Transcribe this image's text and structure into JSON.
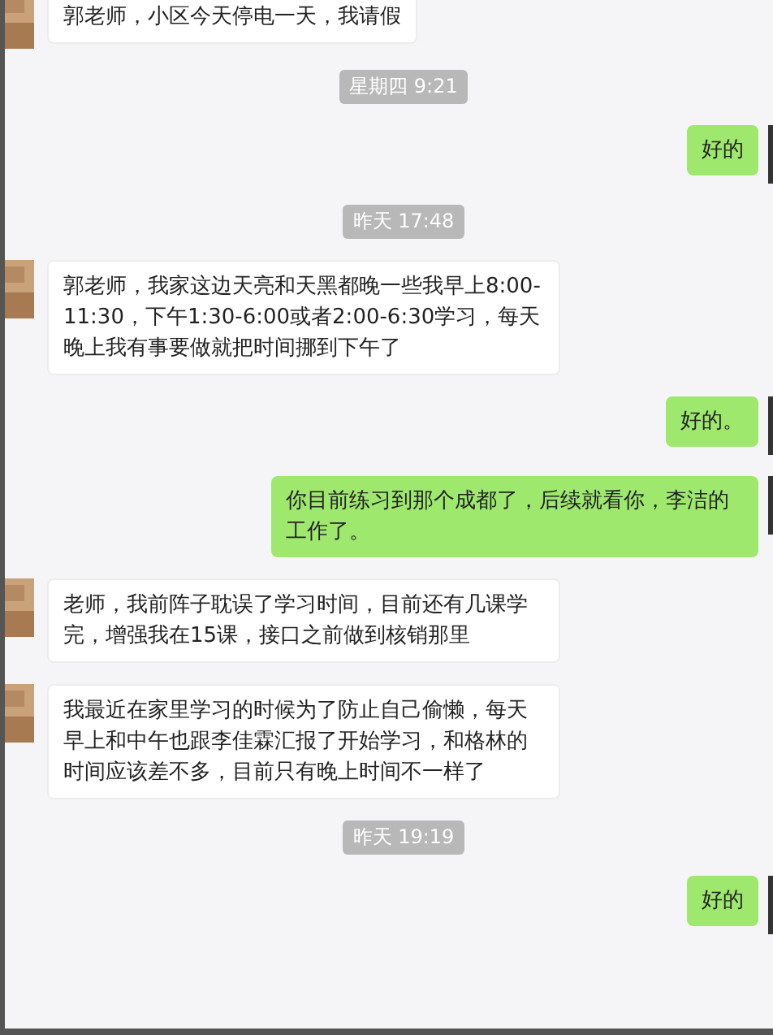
{
  "messages": [
    {
      "kind": "incoming",
      "text": "郭老师，小区今天停电一天，我请假"
    },
    {
      "kind": "time",
      "text": "星期四 9:21"
    },
    {
      "kind": "outgoing",
      "text": "好的"
    },
    {
      "kind": "time",
      "text": "昨天 17:48"
    },
    {
      "kind": "incoming",
      "text": "郭老师，我家这边天亮和天黑都晚一些我早上8:00-11:30，下午1:30-6:00或者2:00-6:30学习，每天晚上我有事要做就把时间挪到下午了"
    },
    {
      "kind": "outgoing",
      "text": "好的。"
    },
    {
      "kind": "outgoing",
      "text": "你目前练习到那个成都了，后续就看你，李洁的工作了。"
    },
    {
      "kind": "incoming",
      "text": "老师，我前阵子耽误了学习时间，目前还有几课学完，增强我在15课，接口之前做到核销那里"
    },
    {
      "kind": "incoming",
      "text": "我最近在家里学习的时候为了防止自己偷懒，每天早上和中午也跟李佳霖汇报了开始学习，和格林的时间应该差不多，目前只有晚上时间不一样了"
    },
    {
      "kind": "time",
      "text": "昨天 19:19"
    },
    {
      "kind": "outgoing",
      "text": "好的"
    }
  ]
}
